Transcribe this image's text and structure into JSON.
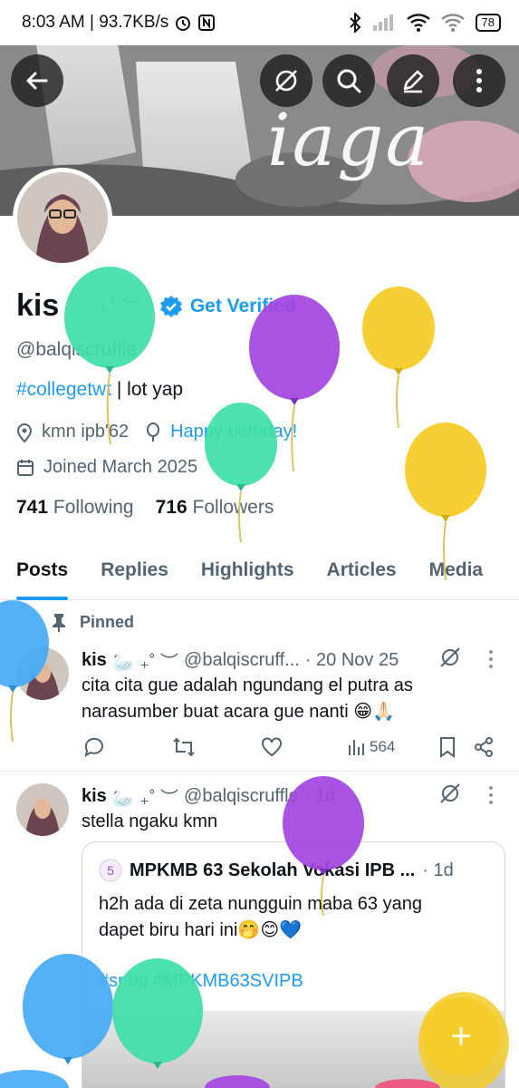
{
  "status_bar": {
    "time_speed": "8:03 AM | 93.7KB/s",
    "battery": "78",
    "icons": [
      "alarm-icon",
      "nfc-icon",
      "bluetooth-icon",
      "signal-icon",
      "wifi-icon",
      "wifi-icon"
    ]
  },
  "header": {
    "banner_text": "iaga",
    "buttons": [
      "back-arrow-icon",
      "grok-icon",
      "search-icon",
      "edit-icon",
      "more-vertical-icon"
    ]
  },
  "profile": {
    "name": "kis",
    "name_decoration": "🦢 ₊˚ ︶",
    "get_verified": "Get Verified",
    "handle": "@balqiscruffle",
    "bio_tag": "#collegetwt",
    "bio_rest": " | lot yap",
    "location": "kmn ipb'62",
    "birthday_link": "Happy birthday!",
    "joined": "Joined March 2025",
    "following_count": "741",
    "following_label": "Following",
    "followers_count": "716",
    "followers_label": "Followers"
  },
  "tabs": [
    "Posts",
    "Replies",
    "Highlights",
    "Articles",
    "Media"
  ],
  "active_tab": "Posts",
  "pinned_label": "Pinned",
  "posts": [
    {
      "name": "kis",
      "deco": "🦢 ₊˚ ︶",
      "handle": "@balqiscruff...",
      "time": "· 20 Nov 25",
      "text_line1": "cita cita gue adalah ngundang el putra as",
      "text_line2": "narasumber buat acara gue nanti 😁🙏🏻",
      "views": "564"
    },
    {
      "name": "kis",
      "deco": "🦢 ₊˚ ︶",
      "handle": "@balqiscruffle",
      "time": "· 1d",
      "text": "stella ngaku kmn",
      "quote": {
        "name": "MPKMB 63 Sekolah Vokasi IPB ...",
        "time": "· 1d",
        "text_line1": "h2h ada di zeta nungguin maba 63 yang",
        "text_line2": "dapet biru hari ini🤭😊💙",
        "tags": "#snbp #MPKMB63SVIPB"
      }
    }
  ],
  "fab_label": "+",
  "colors": {
    "accent": "#1d9bf0",
    "text": "#0f1419",
    "secondary": "#536471",
    "balloon_green": "#3ee0a6",
    "balloon_purple": "#a344e0",
    "balloon_yellow": "#f5cc2a",
    "balloon_blue": "#46aaf5"
  }
}
